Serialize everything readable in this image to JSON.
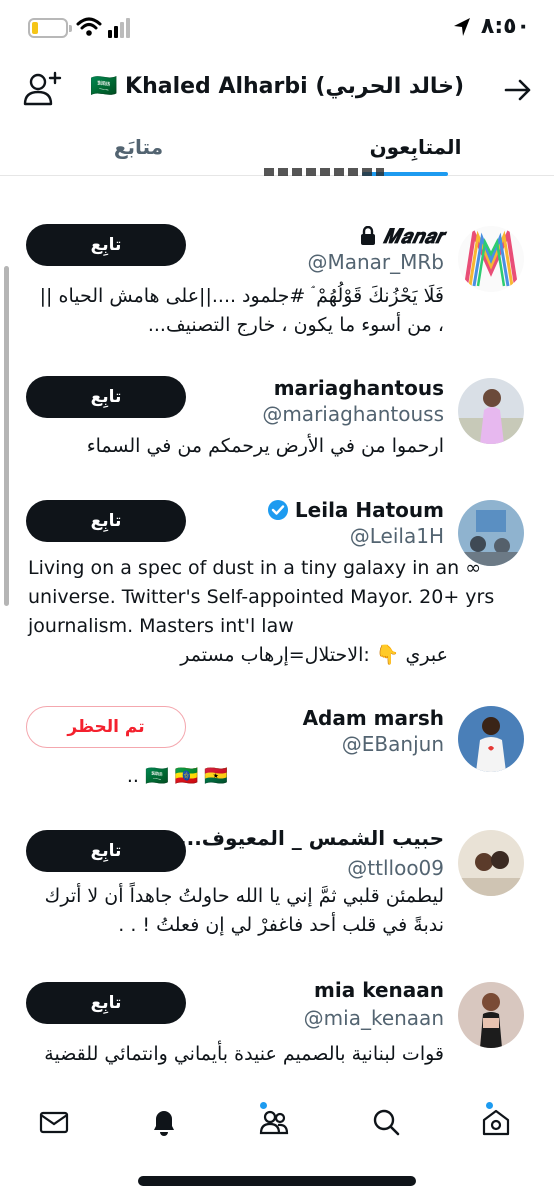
{
  "status_bar": {
    "time": "٨:٥٠"
  },
  "header": {
    "title": "Khaled Alharbi (خالد الحربي)",
    "flag": "🇸🇦"
  },
  "tabs": {
    "following": "متابَع",
    "followers": "المتابِعون"
  },
  "users": [
    {
      "name": "𝑴𝒂𝒏𝒂𝒓",
      "locked": true,
      "handle": "@Manar_MRb",
      "bio": "فَلَا يَحْزُنكَ قَوْلُهُمْ ۘ #جلمود ....||على هامش الحياه || ، من أسوء ما يكون ، خارج التصنيف...",
      "button": "تابِع"
    },
    {
      "name": "mariaghantous",
      "handle": "@mariaghantouss",
      "bio": "ارحموا من في الأرض يرحمكم من في السماء",
      "button": "تابِع"
    },
    {
      "name": "Leila Hatoum",
      "verified": true,
      "handle": "@Leila1H",
      "bio_line1": "Living on a spec of dust in a tiny galaxy in an ∞ universe. Twitter's Self-appointed Mayor. 20+ yrs journalism. Masters int'l law",
      "bio_line2": "عبري 👇 :الاحتلال=إرهاب مستمر",
      "button": "تابِع"
    },
    {
      "name": "Adam marsh",
      "handle": "@EBanjun",
      "bio": "🇸🇦 🇪🇹 🇬🇭 ..",
      "button": "تم الحظر"
    },
    {
      "name": "حبيب الشمس _ المعيوف.....",
      "handle": "@ttlloo09",
      "bio": "ليطمئن قلبي ثمَّ إني يا الله حاولتُ جاهداً أن لا أترك ندبةً في قلب أحد فاغفرْ لي إن فعلتُ ! . .",
      "button": "تابِع"
    },
    {
      "name": "mia kenaan",
      "handle": "@mia_kenaan",
      "bio": "قوات لبنانية بالصميم عنيدة بأيماني وانتمائي للقضية",
      "button": "تابِع"
    }
  ],
  "colors": {
    "accent": "#1d9bf0",
    "text": "#0f1419",
    "secondary": "#536471",
    "blocked": "#f4212e"
  },
  "nav": {
    "icons": [
      "mail-icon",
      "notifications-icon",
      "communities-icon",
      "search-icon",
      "home-icon"
    ]
  }
}
